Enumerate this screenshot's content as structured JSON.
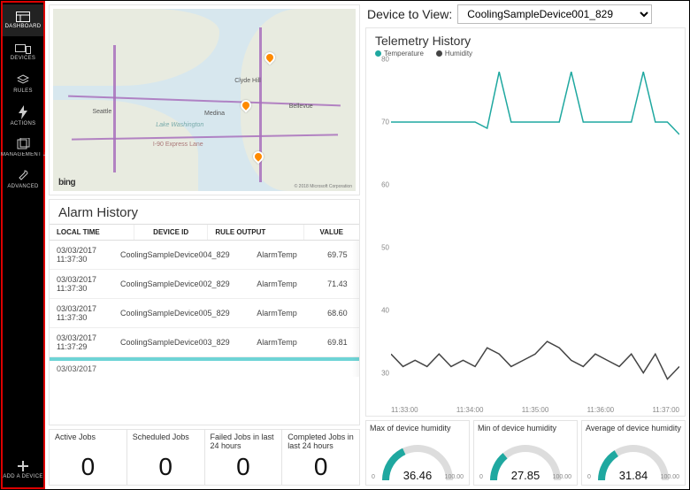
{
  "sidebar": {
    "items": [
      {
        "label": "DASHBOARD",
        "icon": "dashboard"
      },
      {
        "label": "DEVICES",
        "icon": "devices"
      },
      {
        "label": "RULES",
        "icon": "rules"
      },
      {
        "label": "ACTIONS",
        "icon": "actions"
      },
      {
        "label": "MANAGEMENT JOBS",
        "icon": "jobs"
      },
      {
        "label": "ADVANCED",
        "icon": "advanced"
      }
    ],
    "addDevice": {
      "label": "ADD A DEVICE"
    }
  },
  "map": {
    "provider": "bing",
    "attribution": "© 2018 Microsoft Corporation",
    "places": [
      "Seattle",
      "Bellevue",
      "Clyde Hill",
      "Medina",
      "Lake Washington",
      "I-90 Express Lane"
    ]
  },
  "alarm": {
    "title": "Alarm History",
    "columns": [
      "LOCAL TIME",
      "DEVICE ID",
      "RULE OUTPUT",
      "VALUE"
    ],
    "rows": [
      {
        "time": "03/03/2017 11:37:30",
        "device": "CoolingSampleDevice004_829",
        "rule": "AlarmTemp",
        "value": "69.75"
      },
      {
        "time": "03/03/2017 11:37:30",
        "device": "CoolingSampleDevice002_829",
        "rule": "AlarmTemp",
        "value": "71.43"
      },
      {
        "time": "03/03/2017 11:37:30",
        "device": "CoolingSampleDevice005_829",
        "rule": "AlarmTemp",
        "value": "68.60"
      },
      {
        "time": "03/03/2017 11:37:29",
        "device": "CoolingSampleDevice003_829",
        "rule": "AlarmTemp",
        "value": "69.81"
      }
    ]
  },
  "jobs": [
    {
      "title": "Active Jobs",
      "value": "0"
    },
    {
      "title": "Scheduled Jobs",
      "value": "0"
    },
    {
      "title": "Failed Jobs in last 24 hours",
      "value": "0"
    },
    {
      "title": "Completed Jobs in last 24 hours",
      "value": "0"
    }
  ],
  "deviceHeader": {
    "label": "Device to View:",
    "selected": "CoolingSampleDevice001_829"
  },
  "telemetry": {
    "title": "Telemetry History",
    "legend": [
      {
        "name": "Temperature",
        "color": "#1fa8a0"
      },
      {
        "name": "Humidity",
        "color": "#444"
      }
    ]
  },
  "chart_data": {
    "type": "line",
    "xlabel": "",
    "ylabel": "",
    "ylim": [
      25,
      80
    ],
    "xticks": [
      "11:33:00",
      "11:34:00",
      "11:35:00",
      "11:36:00",
      "11:37:00"
    ],
    "yticks": [
      30,
      40,
      50,
      60,
      70,
      80
    ],
    "x": [
      0,
      1,
      2,
      3,
      4,
      5,
      6,
      7,
      8,
      9,
      10,
      11,
      12,
      13,
      14,
      15,
      16,
      17,
      18,
      19,
      20,
      21,
      22,
      23,
      24
    ],
    "series": [
      {
        "name": "Temperature",
        "color": "#1fa8a0",
        "values": [
          70,
          70,
          70,
          70,
          70,
          70,
          70,
          70,
          69,
          78,
          70,
          70,
          70,
          70,
          70,
          78,
          70,
          70,
          70,
          70,
          70,
          78,
          70,
          70,
          68
        ]
      },
      {
        "name": "Humidity",
        "color": "#444",
        "values": [
          33,
          31,
          32,
          31,
          33,
          31,
          32,
          31,
          34,
          33,
          31,
          32,
          33,
          35,
          34,
          32,
          31,
          33,
          32,
          31,
          33,
          30,
          33,
          29,
          31
        ]
      }
    ]
  },
  "gauges": [
    {
      "title": "Max of device humidity",
      "value": "36.46",
      "min": "0",
      "max": "100.00",
      "pct": 0.36,
      "color": "#1fa8a0"
    },
    {
      "title": "Min of device humidity",
      "value": "27.85",
      "min": "0",
      "max": "100.00",
      "pct": 0.28,
      "color": "#1fa8a0"
    },
    {
      "title": "Average of device humidity",
      "value": "31.84",
      "min": "0",
      "max": "100.00",
      "pct": 0.32,
      "color": "#1fa8a0"
    }
  ]
}
